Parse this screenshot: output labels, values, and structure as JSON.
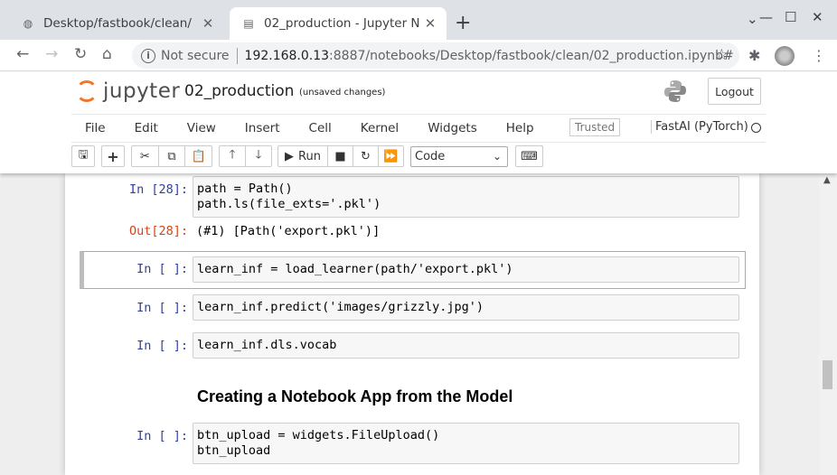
{
  "browser": {
    "tabs": [
      {
        "title": "Desktop/fastbook/clean/"
      },
      {
        "title": "02_production - Jupyter N"
      }
    ],
    "new_tab": "+",
    "address": {
      "security": "Not secure",
      "host": "192.168.0.13",
      "path": ":8887/notebooks/Desktop/fastbook/clean/02_production.ipynb#"
    }
  },
  "jupyter": {
    "logo_text": "jupyter",
    "notebook_name": "02_production",
    "save_status": "(unsaved changes)",
    "logout_label": "Logout",
    "menu": [
      "File",
      "Edit",
      "View",
      "Insert",
      "Cell",
      "Kernel",
      "Widgets",
      "Help"
    ],
    "trusted_label": "Trusted",
    "kernel_name": "FastAI (PyTorch)",
    "toolbar": {
      "run_label": "Run",
      "cell_type": "Code"
    }
  },
  "cells": [
    {
      "prompt": "In [28]:",
      "lines": [
        "path = Path()",
        "path.ls(file_exts='.pkl')"
      ]
    },
    {
      "out_prompt": "Out[28]:",
      "output": "(#1) [Path('export.pkl')]"
    },
    {
      "prompt": "In [ ]:",
      "lines": [
        "learn_inf = load_learner(path/'export.pkl')"
      ]
    },
    {
      "prompt": "In [ ]:",
      "lines": [
        "learn_inf.predict('images/grizzly.jpg')"
      ]
    },
    {
      "prompt": "In [ ]:",
      "lines": [
        "learn_inf.dls.vocab"
      ]
    },
    {
      "heading": "Creating a Notebook App from the Model"
    },
    {
      "prompt": "In [ ]:",
      "lines": [
        "btn_upload = widgets.FileUpload()",
        "btn_upload"
      ]
    }
  ],
  "icons": {
    "tab1": "folder-icon",
    "tab2": "notebook-icon",
    "back": "back-arrow-icon",
    "forward": "forward-arrow-icon",
    "reload": "reload-icon",
    "home": "home-icon",
    "star": "bookmark-star-icon",
    "ext": "extensions-puzzle-icon",
    "menu": "kebab-menu-icon"
  }
}
